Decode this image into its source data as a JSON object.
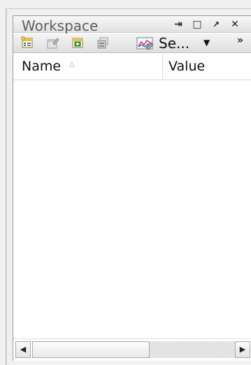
{
  "panel": {
    "title": "Workspace",
    "buttons": {
      "pin": "⇥",
      "maximize": "□",
      "float": "↗",
      "close": "✕"
    }
  },
  "toolbar": {
    "icons": [
      "new-item-icon",
      "edit-item-icon",
      "add-item-icon",
      "copy-item-icon",
      "select-icon"
    ],
    "select_label": "Se...",
    "select_arrow": "▼",
    "overflow": "»"
  },
  "list": {
    "columns": [
      "Name",
      "Value"
    ],
    "sort_indicator": "△",
    "rows": []
  },
  "scrollbar": {
    "left_arrow": "◀",
    "right_arrow": "▶",
    "thumb_fraction": 0.58
  }
}
